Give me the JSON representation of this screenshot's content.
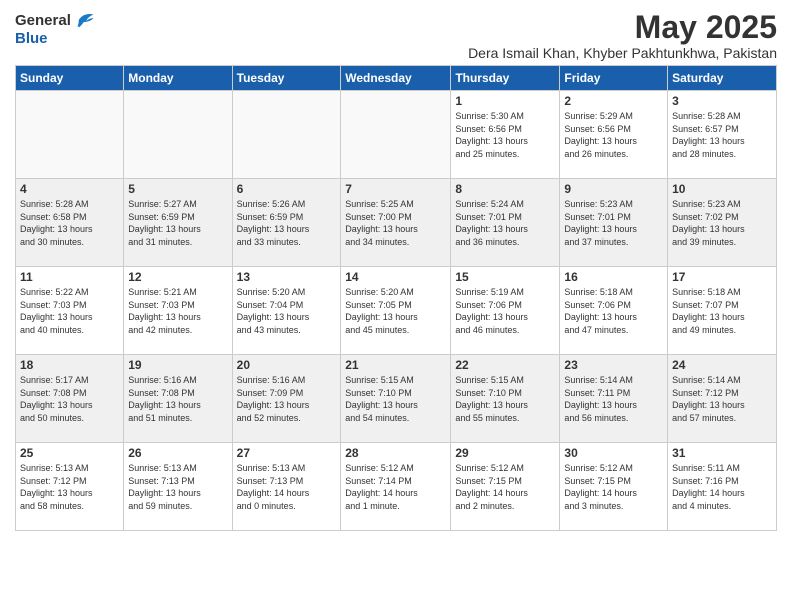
{
  "header": {
    "logo": {
      "general": "General",
      "blue": "Blue"
    },
    "title": "May 2025",
    "location": "Dera Ismail Khan, Khyber Pakhtunkhwa, Pakistan"
  },
  "calendar": {
    "days_of_week": [
      "Sunday",
      "Monday",
      "Tuesday",
      "Wednesday",
      "Thursday",
      "Friday",
      "Saturday"
    ],
    "weeks": [
      [
        {
          "day": "",
          "info": ""
        },
        {
          "day": "",
          "info": ""
        },
        {
          "day": "",
          "info": ""
        },
        {
          "day": "",
          "info": ""
        },
        {
          "day": "1",
          "info": "Sunrise: 5:30 AM\nSunset: 6:56 PM\nDaylight: 13 hours\nand 25 minutes."
        },
        {
          "day": "2",
          "info": "Sunrise: 5:29 AM\nSunset: 6:56 PM\nDaylight: 13 hours\nand 26 minutes."
        },
        {
          "day": "3",
          "info": "Sunrise: 5:28 AM\nSunset: 6:57 PM\nDaylight: 13 hours\nand 28 minutes."
        }
      ],
      [
        {
          "day": "4",
          "info": "Sunrise: 5:28 AM\nSunset: 6:58 PM\nDaylight: 13 hours\nand 30 minutes."
        },
        {
          "day": "5",
          "info": "Sunrise: 5:27 AM\nSunset: 6:59 PM\nDaylight: 13 hours\nand 31 minutes."
        },
        {
          "day": "6",
          "info": "Sunrise: 5:26 AM\nSunset: 6:59 PM\nDaylight: 13 hours\nand 33 minutes."
        },
        {
          "day": "7",
          "info": "Sunrise: 5:25 AM\nSunset: 7:00 PM\nDaylight: 13 hours\nand 34 minutes."
        },
        {
          "day": "8",
          "info": "Sunrise: 5:24 AM\nSunset: 7:01 PM\nDaylight: 13 hours\nand 36 minutes."
        },
        {
          "day": "9",
          "info": "Sunrise: 5:23 AM\nSunset: 7:01 PM\nDaylight: 13 hours\nand 37 minutes."
        },
        {
          "day": "10",
          "info": "Sunrise: 5:23 AM\nSunset: 7:02 PM\nDaylight: 13 hours\nand 39 minutes."
        }
      ],
      [
        {
          "day": "11",
          "info": "Sunrise: 5:22 AM\nSunset: 7:03 PM\nDaylight: 13 hours\nand 40 minutes."
        },
        {
          "day": "12",
          "info": "Sunrise: 5:21 AM\nSunset: 7:03 PM\nDaylight: 13 hours\nand 42 minutes."
        },
        {
          "day": "13",
          "info": "Sunrise: 5:20 AM\nSunset: 7:04 PM\nDaylight: 13 hours\nand 43 minutes."
        },
        {
          "day": "14",
          "info": "Sunrise: 5:20 AM\nSunset: 7:05 PM\nDaylight: 13 hours\nand 45 minutes."
        },
        {
          "day": "15",
          "info": "Sunrise: 5:19 AM\nSunset: 7:06 PM\nDaylight: 13 hours\nand 46 minutes."
        },
        {
          "day": "16",
          "info": "Sunrise: 5:18 AM\nSunset: 7:06 PM\nDaylight: 13 hours\nand 47 minutes."
        },
        {
          "day": "17",
          "info": "Sunrise: 5:18 AM\nSunset: 7:07 PM\nDaylight: 13 hours\nand 49 minutes."
        }
      ],
      [
        {
          "day": "18",
          "info": "Sunrise: 5:17 AM\nSunset: 7:08 PM\nDaylight: 13 hours\nand 50 minutes."
        },
        {
          "day": "19",
          "info": "Sunrise: 5:16 AM\nSunset: 7:08 PM\nDaylight: 13 hours\nand 51 minutes."
        },
        {
          "day": "20",
          "info": "Sunrise: 5:16 AM\nSunset: 7:09 PM\nDaylight: 13 hours\nand 52 minutes."
        },
        {
          "day": "21",
          "info": "Sunrise: 5:15 AM\nSunset: 7:10 PM\nDaylight: 13 hours\nand 54 minutes."
        },
        {
          "day": "22",
          "info": "Sunrise: 5:15 AM\nSunset: 7:10 PM\nDaylight: 13 hours\nand 55 minutes."
        },
        {
          "day": "23",
          "info": "Sunrise: 5:14 AM\nSunset: 7:11 PM\nDaylight: 13 hours\nand 56 minutes."
        },
        {
          "day": "24",
          "info": "Sunrise: 5:14 AM\nSunset: 7:12 PM\nDaylight: 13 hours\nand 57 minutes."
        }
      ],
      [
        {
          "day": "25",
          "info": "Sunrise: 5:13 AM\nSunset: 7:12 PM\nDaylight: 13 hours\nand 58 minutes."
        },
        {
          "day": "26",
          "info": "Sunrise: 5:13 AM\nSunset: 7:13 PM\nDaylight: 13 hours\nand 59 minutes."
        },
        {
          "day": "27",
          "info": "Sunrise: 5:13 AM\nSunset: 7:13 PM\nDaylight: 14 hours\nand 0 minutes."
        },
        {
          "day": "28",
          "info": "Sunrise: 5:12 AM\nSunset: 7:14 PM\nDaylight: 14 hours\nand 1 minute."
        },
        {
          "day": "29",
          "info": "Sunrise: 5:12 AM\nSunset: 7:15 PM\nDaylight: 14 hours\nand 2 minutes."
        },
        {
          "day": "30",
          "info": "Sunrise: 5:12 AM\nSunset: 7:15 PM\nDaylight: 14 hours\nand 3 minutes."
        },
        {
          "day": "31",
          "info": "Sunrise: 5:11 AM\nSunset: 7:16 PM\nDaylight: 14 hours\nand 4 minutes."
        }
      ]
    ]
  }
}
